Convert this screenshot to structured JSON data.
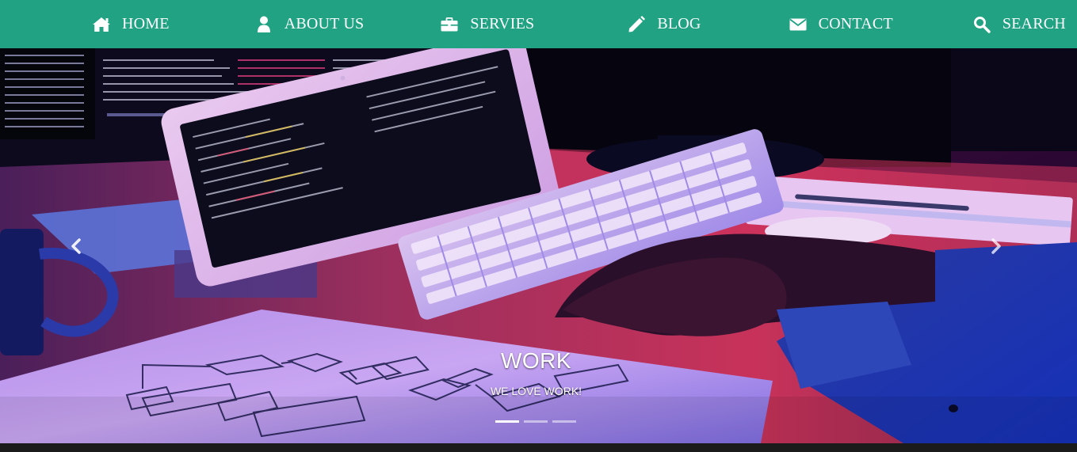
{
  "nav": {
    "items": [
      {
        "label": "HOME",
        "icon": "home-icon"
      },
      {
        "label": "ABOUT US",
        "icon": "user-icon"
      },
      {
        "label": "SERVIES",
        "icon": "briefcase-icon"
      },
      {
        "label": "BLOG",
        "icon": "pencil-icon"
      },
      {
        "label": "CONTACT",
        "icon": "envelope-icon"
      },
      {
        "label": "SEARCH",
        "icon": "search-icon"
      }
    ],
    "background": "#20a283",
    "text_color": "#ffffff"
  },
  "carousel": {
    "caption_title": "WORK",
    "caption_subtitle": "WE LOVE WORK!",
    "slide_count": 3,
    "active_index": 0,
    "prev_icon": "chevron-left-icon",
    "next_icon": "chevron-right-icon"
  }
}
